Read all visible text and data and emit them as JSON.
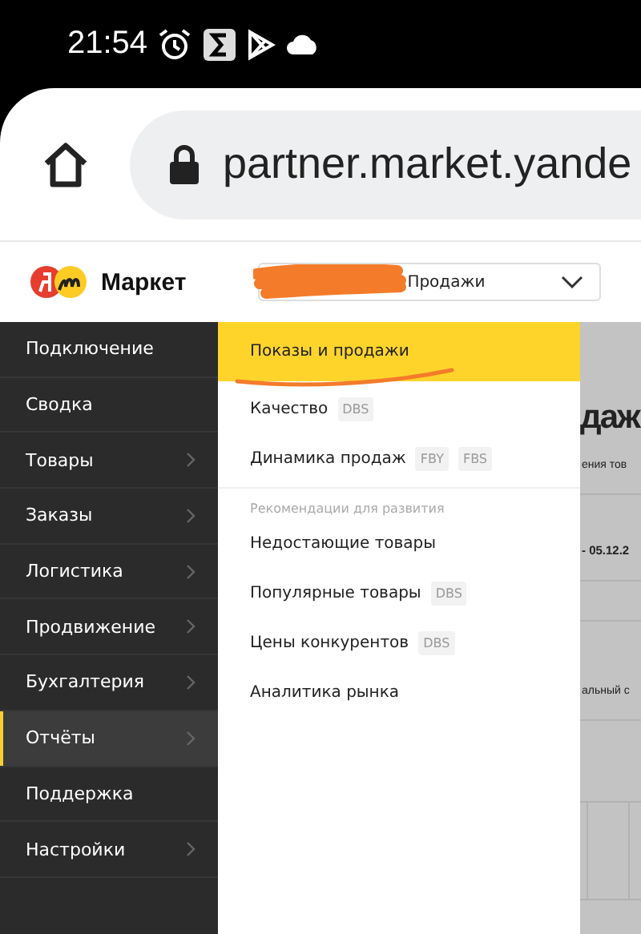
{
  "status_bar": {
    "time": "21:54"
  },
  "browser": {
    "url": "partner.market.yande"
  },
  "header": {
    "logo_text": "Маркет",
    "dropdown": {
      "value": "Продажи"
    }
  },
  "sidebar": {
    "items": [
      {
        "label": "Подключение",
        "chevron": false,
        "selected": false
      },
      {
        "label": "Сводка",
        "chevron": false,
        "selected": false
      },
      {
        "label": "Товары",
        "chevron": true,
        "selected": false
      },
      {
        "label": "Заказы",
        "chevron": true,
        "selected": false
      },
      {
        "label": "Логистика",
        "chevron": true,
        "selected": false
      },
      {
        "label": "Продвижение",
        "chevron": true,
        "selected": false
      },
      {
        "label": "Бухгалтерия",
        "chevron": true,
        "selected": false
      },
      {
        "label": "Отчёты",
        "chevron": true,
        "selected": true
      },
      {
        "label": "Поддержка",
        "chevron": false,
        "selected": false
      },
      {
        "label": "Настройки",
        "chevron": true,
        "selected": false
      }
    ]
  },
  "menu": {
    "items": [
      {
        "kind": "item",
        "label": "Показы и продажи",
        "selected": true
      },
      {
        "kind": "item",
        "label": "Качество",
        "badges": [
          "DBS"
        ],
        "selected": false
      },
      {
        "kind": "item",
        "label": "Динамика продаж",
        "badges": [
          "FBY",
          "FBS"
        ],
        "selected": false
      },
      {
        "kind": "section",
        "label": "Рекомендации для развития"
      },
      {
        "kind": "item",
        "label": "Недостающие товары",
        "selected": false
      },
      {
        "kind": "item",
        "label": "Популярные товары",
        "badges": [
          "DBS"
        ],
        "selected": false
      },
      {
        "kind": "item",
        "label": "Цены конкурентов",
        "badges": [
          "DBS"
        ],
        "selected": false
      },
      {
        "kind": "item",
        "label": "Аналитика рынка",
        "selected": false
      }
    ]
  },
  "page_behind": {
    "heading": "даж",
    "texts": [
      "ения тов",
      "- 05.12.2",
      "альный с"
    ]
  }
}
